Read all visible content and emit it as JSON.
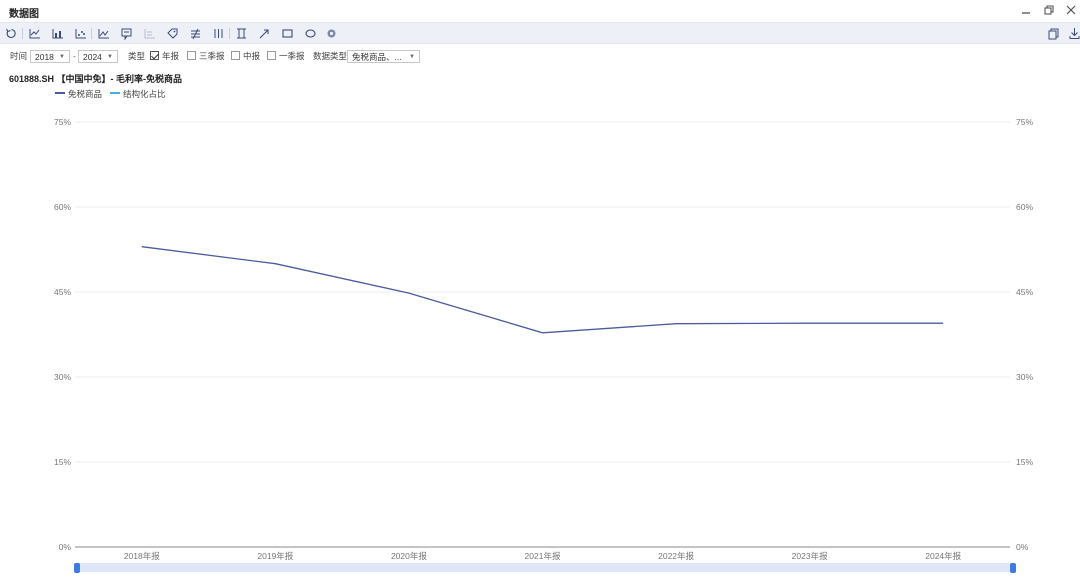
{
  "window": {
    "title": "数据图",
    "controls": [
      "minimize-icon",
      "restore-icon",
      "close-icon"
    ]
  },
  "toolbar": {
    "tools": [
      "refresh-icon",
      "line-chart-icon",
      "bar-chart-icon",
      "scatter-chart-icon",
      "area-chart-icon",
      "comment-icon",
      "table-icon",
      "tag-icon",
      "ratio-icon",
      "columns-icon",
      "bracket-icon",
      "arrow-icon",
      "rectangle-icon",
      "ellipse-icon",
      "color-icon"
    ],
    "right_tools": [
      "copy-icon",
      "download-icon"
    ]
  },
  "filters": {
    "time_label": "时间",
    "start_year": "2018",
    "dash": "-",
    "end_year": "2024",
    "type_label": "类型",
    "types": [
      {
        "label": "年报",
        "checked": true
      },
      {
        "label": "三季报",
        "checked": false
      },
      {
        "label": "中报",
        "checked": false
      },
      {
        "label": "一季报",
        "checked": false
      }
    ],
    "data_type_label": "数据类型",
    "data_type_value": "免税商品、..."
  },
  "chart_title": "601888.SH 【中国中免】- 毛利率-免税商品",
  "legend": [
    {
      "label": "免税商品",
      "color": "#4a5c9e"
    },
    {
      "label": "结构化占比",
      "color": "#3fb3e0"
    }
  ],
  "chart_data": {
    "type": "line",
    "categories": [
      "2018年报",
      "2019年报",
      "2020年报",
      "2021年报",
      "2022年报",
      "2023年报",
      "2024年报"
    ],
    "series": [
      {
        "name": "免税商品",
        "color": "#4a5c9e",
        "values": [
          53.0,
          50.0,
          44.8,
          37.8,
          39.4,
          39.5,
          39.5
        ]
      }
    ],
    "yticks": [
      "0%",
      "15%",
      "30%",
      "45%",
      "60%",
      "75%"
    ],
    "y2ticks": [
      "0%",
      "15%",
      "30%",
      "45%",
      "60%",
      "75%"
    ],
    "ylim": [
      0,
      75
    ],
    "grid": true,
    "legend_position": "top-left"
  }
}
